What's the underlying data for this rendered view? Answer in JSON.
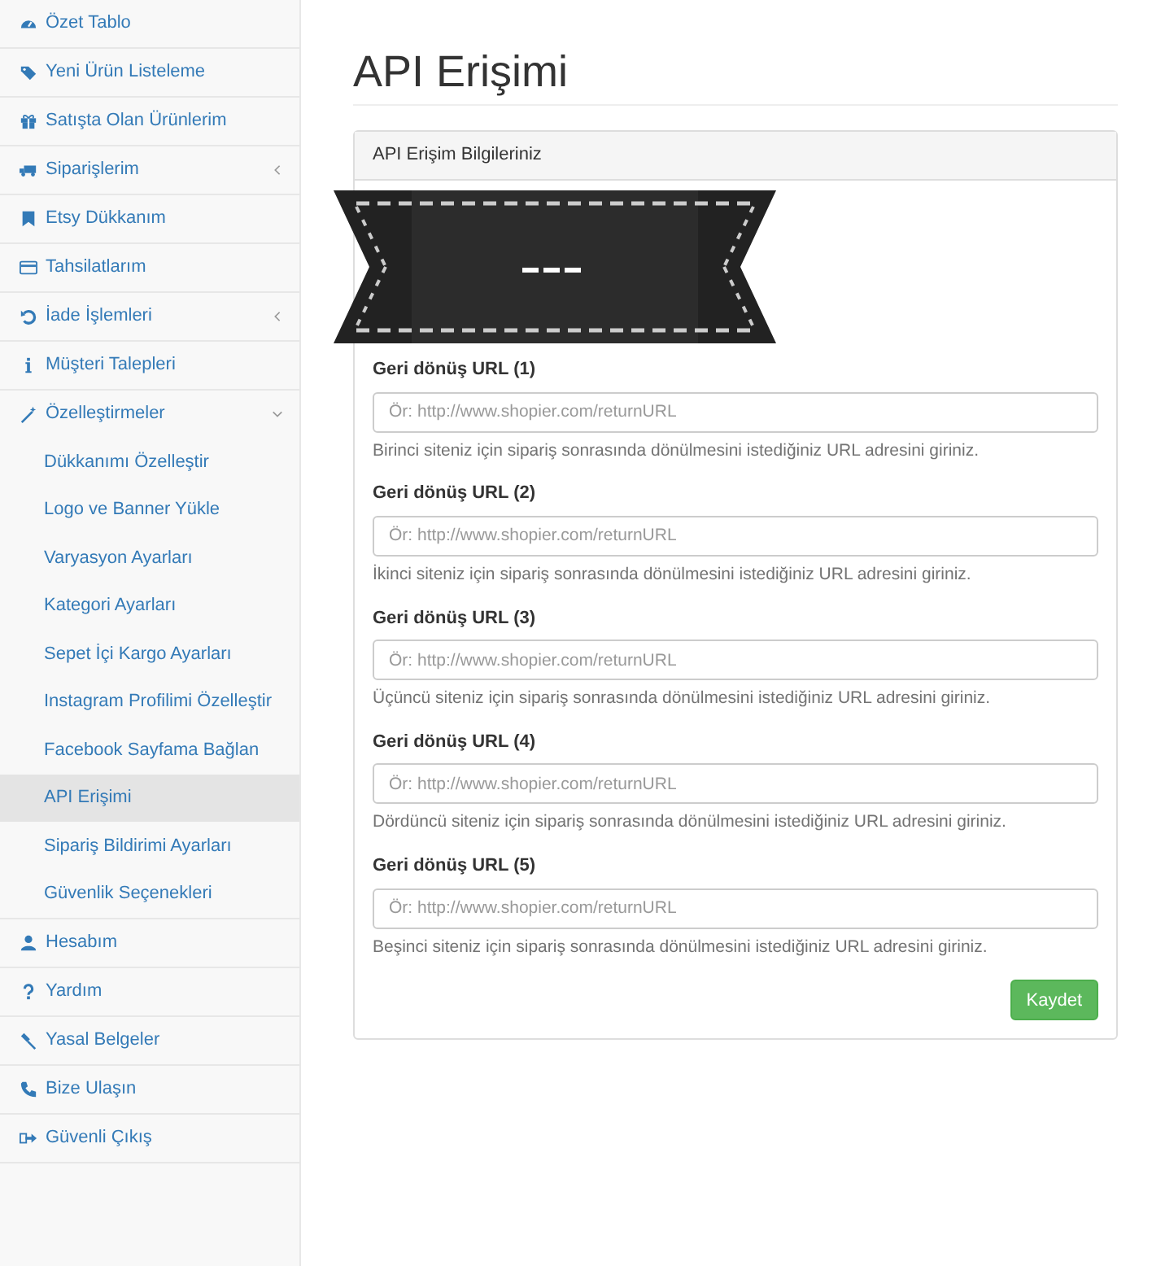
{
  "sidebar": {
    "items": [
      {
        "label": "Özet Tablo",
        "selected": false
      },
      {
        "label": "Yeni Ürün Listeleme",
        "selected": false
      },
      {
        "label": "Satışta Olan Ürünlerim",
        "selected": false
      },
      {
        "label": "Siparişlerim",
        "selected": false,
        "expanded": false
      },
      {
        "label": "Etsy Dükkanım",
        "selected": false
      },
      {
        "label": "Tahsilatlarım",
        "selected": false
      },
      {
        "label": "İade İşlemleri",
        "selected": false,
        "expanded": false
      },
      {
        "label": "Müşteri Talepleri",
        "selected": false
      },
      {
        "label": "Özelleştirmeler",
        "selected": false,
        "expanded": true,
        "children": [
          {
            "label": "Dükkanımı Özelleştir",
            "selected": false
          },
          {
            "label": "Logo ve Banner Yükle",
            "selected": false
          },
          {
            "label": "Varyasyon Ayarları",
            "selected": false
          },
          {
            "label": "Kategori Ayarları",
            "selected": false
          },
          {
            "label": "Sepet İçi Kargo Ayarları",
            "selected": false
          },
          {
            "label": "Instagram Profilimi Özelleştir",
            "selected": false
          },
          {
            "label": "Facebook Sayfama Bağlan",
            "selected": false
          },
          {
            "label": "API Erişimi",
            "selected": true
          },
          {
            "label": "Sipariş Bildirimi Ayarları",
            "selected": false
          },
          {
            "label": "Güvenlik Seçenekleri",
            "selected": false
          }
        ]
      },
      {
        "label": "Hesabım",
        "selected": false
      },
      {
        "label": "Yardım",
        "selected": false
      },
      {
        "label": "Yasal Belgeler",
        "selected": false
      },
      {
        "label": "Bize Ulaşın",
        "selected": false
      },
      {
        "label": "Güvenli Çıkış",
        "selected": false
      }
    ]
  },
  "page": {
    "title": "API Erişimi",
    "panel": {
      "heading": "API Erişim Bilgileriniz",
      "fields": [
        {
          "label": "Geri dönüş URL (1)",
          "placeholder": "Ör: http://www.shopier.com/returnURL",
          "help": "Birinci siteniz için sipariş sonrasında dönülmesini istediğiniz URL adresini giriniz."
        },
        {
          "label": "Geri dönüş URL (2)",
          "placeholder": "Ör: http://www.shopier.com/returnURL",
          "help": "İkinci siteniz için sipariş sonrasında dönülmesini istediğiniz URL adresini giriniz."
        },
        {
          "label": "Geri dönüş URL (3)",
          "placeholder": "Ör: http://www.shopier.com/returnURL",
          "help": "Üçüncü siteniz için sipariş sonrasında dönülmesini istediğiniz URL adresini giriniz."
        },
        {
          "label": "Geri dönüş URL (4)",
          "placeholder": "Ör: http://www.shopier.com/returnURL",
          "help": "Dördüncü siteniz için sipariş sonrasında dönülmesini istediğiniz URL adresini giriniz."
        },
        {
          "label": "Geri dönüş URL (5)",
          "placeholder": "Ör: http://www.shopier.com/returnURL",
          "help": "Beşinci siteniz için sipariş sonrasında dönülmesini istediğiniz URL adresini giriniz."
        }
      ],
      "save_button": "Kaydet"
    }
  }
}
